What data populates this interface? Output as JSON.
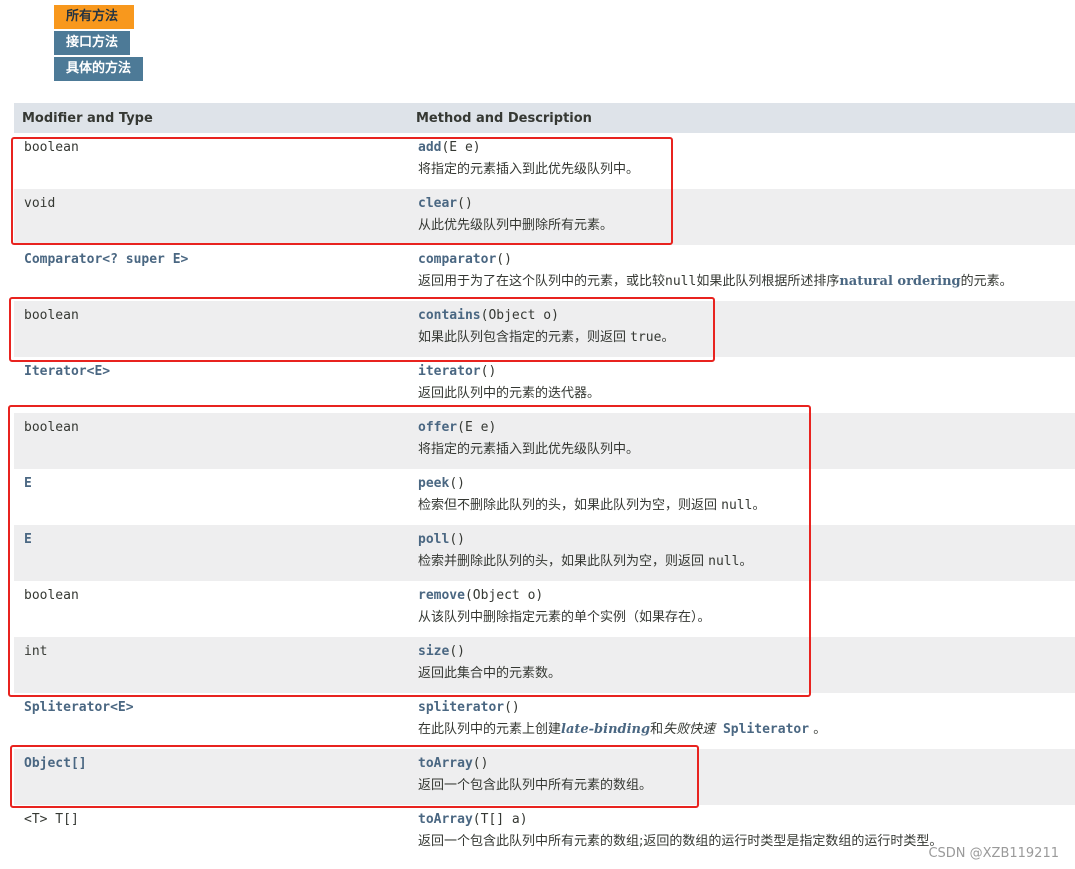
{
  "tabs": [
    {
      "label": "所有方法",
      "active": true
    },
    {
      "label": "接口方法",
      "active": false
    },
    {
      "label": "具体的方法",
      "active": false
    }
  ],
  "table": {
    "headers": [
      "Modifier and Type",
      "Method and Description"
    ],
    "rows": [
      {
        "type": "boolean",
        "type_link": false,
        "method": "add",
        "params": "(E e)",
        "desc": "将指定的元素插入到此优先级队列中。"
      },
      {
        "type": "void",
        "type_link": false,
        "method": "clear",
        "params": "()",
        "desc": "从此优先级队列中删除所有元素。"
      },
      {
        "type": "Comparator<? super E>",
        "type_link": true,
        "method": "comparator",
        "params": "()",
        "desc_parts": [
          "返回用于为了在这个队列中的元素，或比较",
          "null",
          "如果此队列根据所述排序",
          "natural ordering",
          "的元素。"
        ]
      },
      {
        "type": "boolean",
        "type_link": false,
        "method": "contains",
        "params": "(Object o)",
        "desc_parts": [
          "如果此队列包含指定的元素，则返回 ",
          "true",
          "。"
        ]
      },
      {
        "type": "Iterator<E>",
        "type_link": true,
        "method": "iterator",
        "params": "()",
        "desc": "返回此队列中的元素的迭代器。"
      },
      {
        "type": "boolean",
        "type_link": false,
        "method": "offer",
        "params": "(E e)",
        "desc": "将指定的元素插入到此优先级队列中。"
      },
      {
        "type": "E",
        "type_link": true,
        "method": "peek",
        "params": "()",
        "desc_parts": [
          "检索但不删除此队列的头，如果此队列为空，则返回 ",
          "null",
          "。"
        ]
      },
      {
        "type": "E",
        "type_link": true,
        "method": "poll",
        "params": "()",
        "desc_parts": [
          "检索并删除此队列的头，如果此队列为空，则返回 ",
          "null",
          "。"
        ]
      },
      {
        "type": "boolean",
        "type_link": false,
        "method": "remove",
        "params": "(Object o)",
        "desc": "从该队列中删除指定元素的单个实例（如果存在）。"
      },
      {
        "type": "int",
        "type_link": false,
        "method": "size",
        "params": "()",
        "desc": "返回此集合中的元素数。"
      },
      {
        "type": "Spliterator<E>",
        "type_link": true,
        "method": "spliterator",
        "params": "()",
        "desc_parts": [
          "在此队列中的元素上创建",
          "late-binding",
          "和",
          "失败快速",
          " Spliterator",
          " 。"
        ]
      },
      {
        "type": "Object[]",
        "type_link": true,
        "method": "toArray",
        "params": "()",
        "desc": "返回一个包含此队列中所有元素的数组。"
      },
      {
        "type": "<T> T[]",
        "type_link": false,
        "method": "toArray",
        "params": "(T[] a)",
        "desc": "返回一个包含此队列中所有元素的数组;返回的数组的运行时类型是指定数组的运行时类型。"
      }
    ]
  },
  "watermark": "CSDN @XZB119211",
  "colors": {
    "highlight": "#e8231f",
    "link": "#4a6782",
    "header_bg": "#dee3e9",
    "tab_active": "#f8981d",
    "tab_inactive": "#4d7a97"
  }
}
